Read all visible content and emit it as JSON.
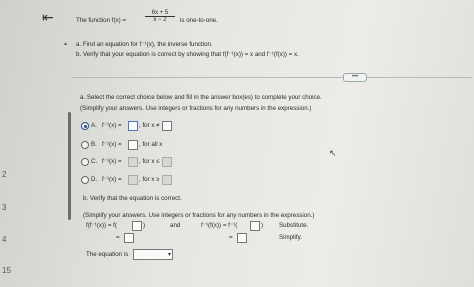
{
  "left_margin_numbers": [
    "2",
    "3",
    "4",
    "15"
  ],
  "nav": {
    "back_icon": "back-arrow-icon"
  },
  "problem": {
    "prefix": "The function f(x) =",
    "numerator": "6x + 5",
    "denominator": "x − 2",
    "suffix": "is one-to-one."
  },
  "tasks": {
    "a": "a. Find an equation for f⁻¹(x), the inverse function.",
    "b": "b. Verify that your equation is correct by showing that f(f⁻¹(x)) = x and f⁻¹(f(x)) = x."
  },
  "more_label": "•••",
  "part_a": {
    "instruction": "a. Select the correct choice below and fill in the answer box(es) to complete your choice.",
    "hint": "(Simplify your answers. Use integers or fractions for any numbers in the expression.)",
    "options": [
      {
        "letter": "A.",
        "expr": "f⁻¹(x) =",
        "cond": ", for x ≠",
        "selected": true
      },
      {
        "letter": "B.",
        "expr": "f⁻¹(x) =",
        "cond": ", for all x",
        "selected": false
      },
      {
        "letter": "C.",
        "expr": "f⁻¹(x) =",
        "cond": ", for x ≤",
        "selected": false
      },
      {
        "letter": "D.",
        "expr": "f⁻¹(x) =",
        "cond": ", for x ≥",
        "selected": false
      }
    ]
  },
  "part_b": {
    "title": "b. Verify that the equation is correct.",
    "hint": "(Simplify your answers. Use integers or fractions for any numbers in the expression.)",
    "left_expr": "f(f⁻¹(x)) = f(",
    "left_close": ")",
    "and_label": "and",
    "right_expr": "f⁻¹(f(x)) = f⁻¹(",
    "right_close": ")",
    "substitute_label": "Substitute.",
    "eq1": "=",
    "eq2": "=",
    "simplify_label": "Simplify.",
    "equation_is_label": "The equation is",
    "dropdown_arrow": "▾"
  }
}
